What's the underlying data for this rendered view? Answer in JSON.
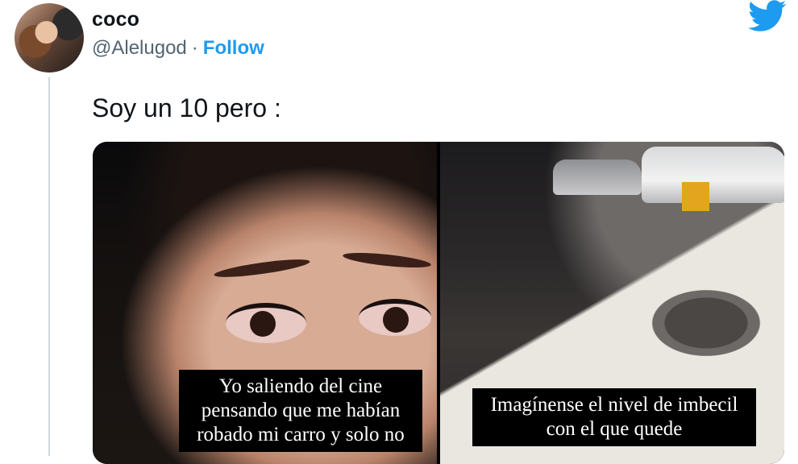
{
  "user": {
    "display_name": "coco",
    "handle": "@Alelugod",
    "separator": "·",
    "follow_label": "Follow"
  },
  "icons": {
    "brand": "twitter-bird-icon",
    "brand_color": "#1d9bf0",
    "follow_color": "#1d9bf0"
  },
  "tweet": {
    "text": "Soy un 10 pero :"
  },
  "media": {
    "left_caption": "Yo saliendo del cine pensando que me habían robado mi carro y solo no",
    "right_caption": "Imagínense el nivel de imbecil con el que quede"
  }
}
